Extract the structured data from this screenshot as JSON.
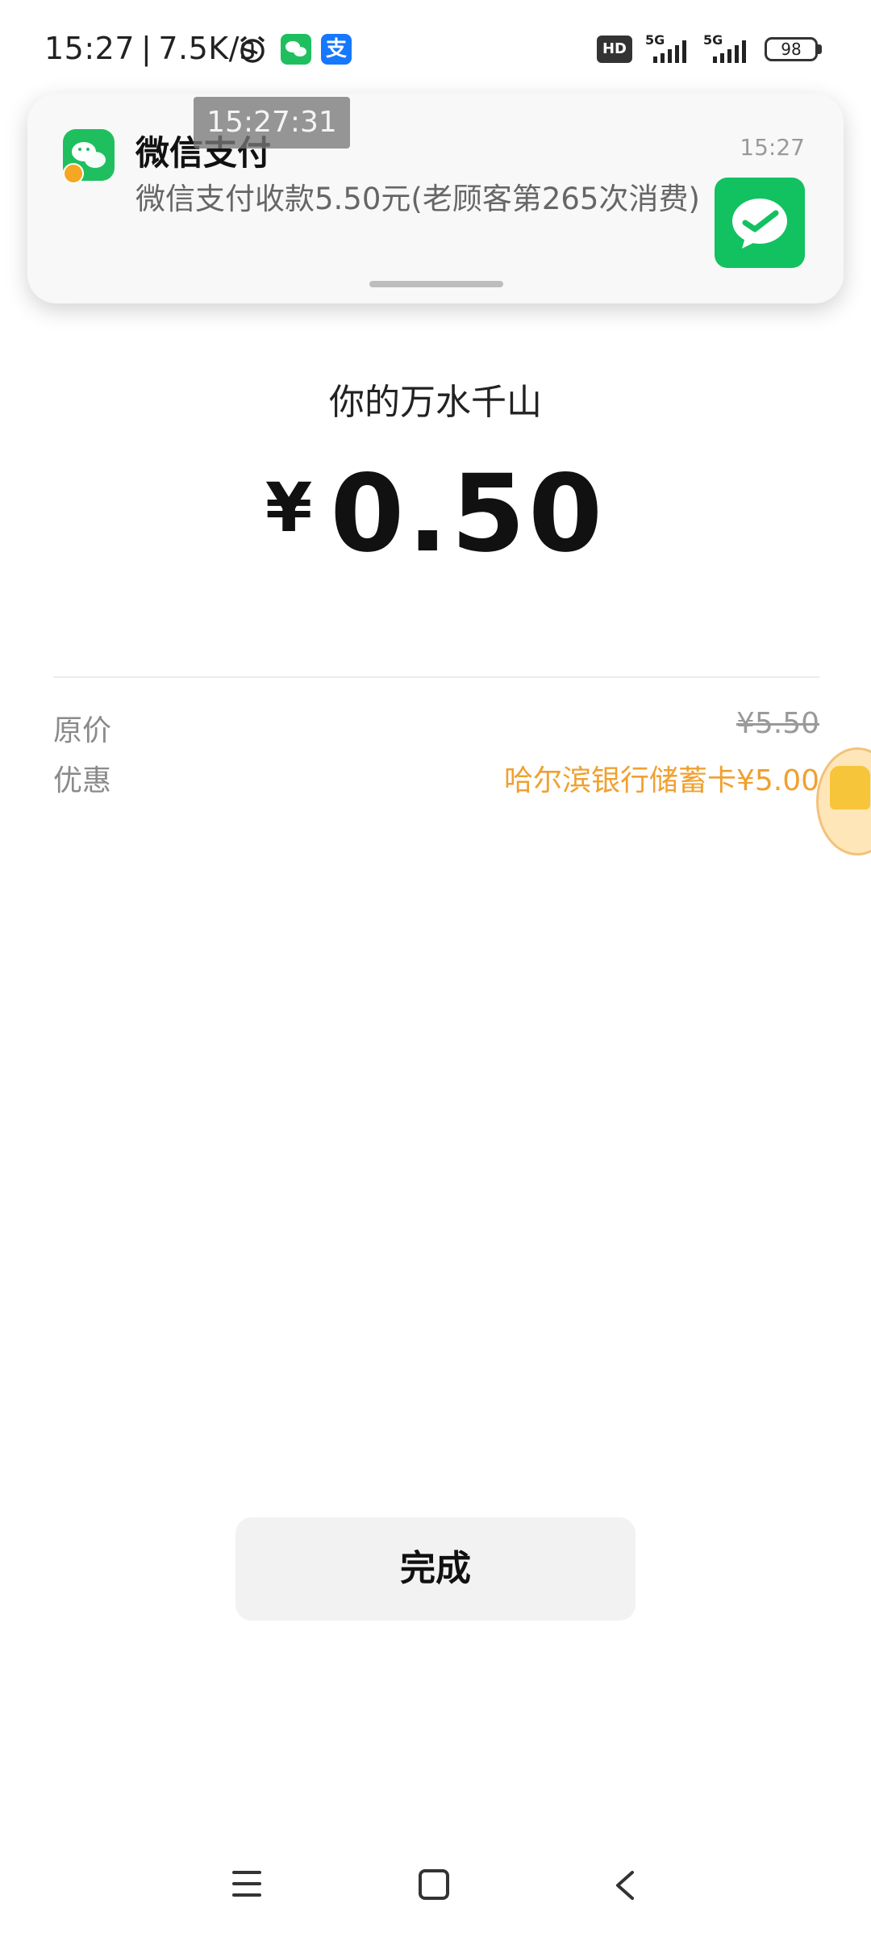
{
  "status_bar": {
    "time": "15:27",
    "network_speed": "7.5K/s",
    "battery": "98",
    "hd_label": "HD",
    "sim1_label": "5G",
    "sim2_label": "5G",
    "alipay_glyph": "支",
    "icons": [
      "alarm-icon",
      "wechat-icon",
      "alipay-icon",
      "hd-icon",
      "signal-icon",
      "signal-icon",
      "battery-icon"
    ]
  },
  "notification": {
    "app": "微信支付",
    "body": "微信支付收款5.50元(老顾客第265次消费)",
    "time": "15:27"
  },
  "overlay_time": "15:27:31",
  "payment": {
    "merchant": "你的万水千山",
    "currency": "¥",
    "amount": "0.50",
    "original_price_label": "原价",
    "original_price": "¥5.50",
    "discount_label": "优惠",
    "discount_value": "哈尔滨银行储蓄卡¥5.00"
  },
  "done_label": "完成",
  "colors": {
    "wechat_green": "#1fbf5f",
    "discount_orange": "#f0a030",
    "alipay_blue": "#1677ff"
  }
}
